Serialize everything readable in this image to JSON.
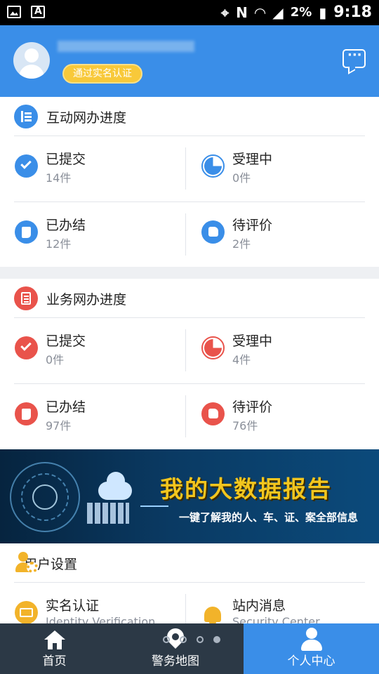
{
  "status_bar": {
    "time": "9:18",
    "battery": "2%"
  },
  "header": {
    "verify_badge": "通过实名认证"
  },
  "interactive_progress": {
    "title": "互动网办进度",
    "items": [
      {
        "label": "已提交",
        "count": "14件"
      },
      {
        "label": "受理中",
        "count": "0件"
      },
      {
        "label": "已办结",
        "count": "12件"
      },
      {
        "label": "待评价",
        "count": "2件"
      }
    ]
  },
  "business_progress": {
    "title": "业务网办进度",
    "items": [
      {
        "label": "已提交",
        "count": "0件"
      },
      {
        "label": "受理中",
        "count": "4件"
      },
      {
        "label": "已办结",
        "count": "97件"
      },
      {
        "label": "待评价",
        "count": "76件"
      }
    ]
  },
  "banner": {
    "title": "我的大数据报告",
    "subtitle": "一键了解我的人、车、证、案全部信息"
  },
  "user_settings": {
    "title": "用户设置",
    "items": [
      {
        "label": "实名认证",
        "sub": "Identity Verification"
      },
      {
        "label": "站内消息",
        "sub": "Security Center"
      }
    ]
  },
  "nav": {
    "items": [
      {
        "label": "首页"
      },
      {
        "label": "警务地图"
      },
      {
        "label": "个人中心"
      }
    ],
    "active": "个人中心"
  },
  "colors": {
    "primary": "#3a8ee8",
    "accent_red": "#e9534b",
    "accent_yellow": "#f2b32a",
    "nav_bg": "#2c3946"
  }
}
